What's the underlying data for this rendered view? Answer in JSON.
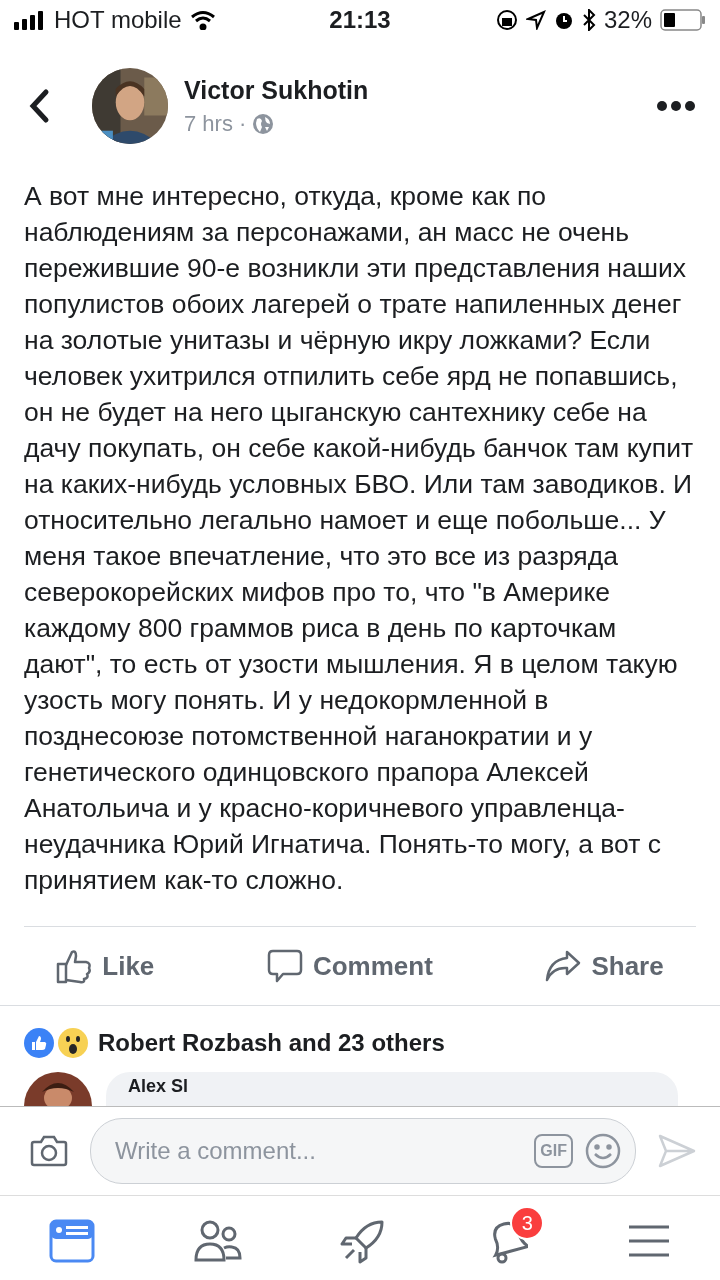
{
  "status_bar": {
    "carrier": "HOT mobile",
    "time": "21:13",
    "battery": "32%"
  },
  "post": {
    "author": "Victor Sukhotin",
    "time": "7 hrs",
    "separator": "·",
    "text": "А вот мне интересно, откуда, кроме как по наблюдениям за персонажами, ан масс не очень пережившие 90-е возникли эти представления наших популистов обоих лагерей о трате напиленных денег на золотые унитазы и чёрную икру ложками? Если человек ухитрился отпилить себе ярд не попавшись, он не будет на него цыганскую сантехнику себе на дачу покупать, он себе какой-нибудь банчок там купит на каких-нибудь условных БВО. Или там заводиков. И относительно легально намоет и еще побольше... У меня такое впечатление, что это все из разряда северокорейских мифов про то, что \"в Америке каждому 800 граммов риса в день по карточкам дают\", то есть от узости мышления. Я в целом такую узость могу понять. И у недокормленной в позднесоюзе потомственной наганократии и у генетического одинцовского прапора Алексей Анатольича и у красно-коричневого управленца-неудачника Юрий Игнатича. Понять-то могу, а вот с принятием как-то сложно."
  },
  "actions": [
    {
      "kind": "like",
      "label": "Like"
    },
    {
      "kind": "comment",
      "label": "Comment"
    },
    {
      "kind": "share",
      "label": "Share"
    }
  ],
  "reactions": {
    "icons": [
      {
        "kind": "like"
      },
      {
        "kind": "wow"
      }
    ],
    "summary": "Robert Rozbash and 23 others"
  },
  "comments": [
    {
      "author": "Alex Sl"
    }
  ],
  "comment_bar": {
    "placeholder": "Write a comment...",
    "gif": "GIF"
  },
  "tab_bar": [
    {
      "kind": "feed",
      "selected": true
    },
    {
      "kind": "friends",
      "selected": false
    },
    {
      "kind": "rocket",
      "selected": false
    },
    {
      "kind": "notifications",
      "selected": false,
      "badge": "3"
    },
    {
      "kind": "menu",
      "selected": false
    }
  ]
}
